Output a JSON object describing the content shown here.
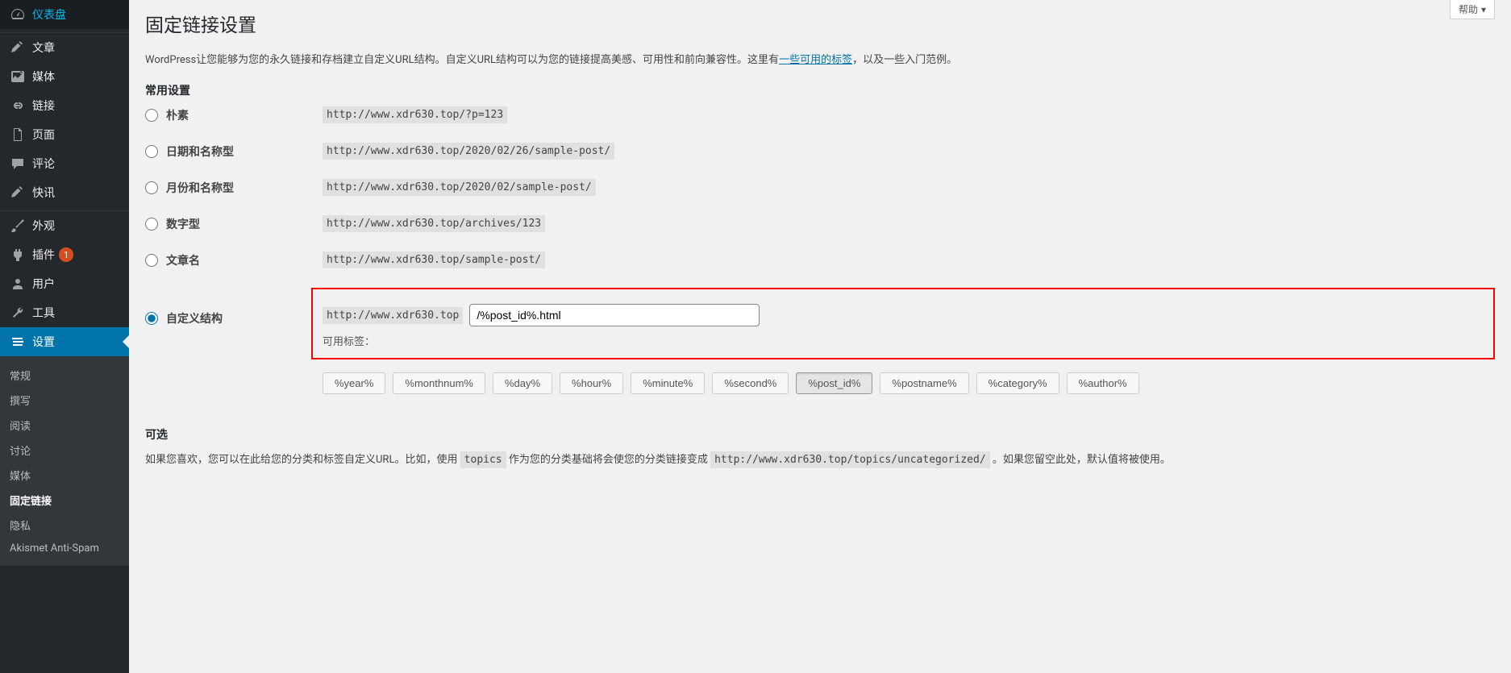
{
  "sidebar": {
    "main_items": [
      {
        "key": "dashboard",
        "label": "仪表盘"
      },
      {
        "key": "posts",
        "label": "文章"
      },
      {
        "key": "media",
        "label": "媒体"
      },
      {
        "key": "links",
        "label": "链接"
      },
      {
        "key": "pages",
        "label": "页面"
      },
      {
        "key": "comments",
        "label": "评论"
      },
      {
        "key": "news",
        "label": "快讯"
      },
      {
        "key": "appearance",
        "label": "外观"
      },
      {
        "key": "plugins",
        "label": "插件",
        "badge": "1"
      },
      {
        "key": "users",
        "label": "用户"
      },
      {
        "key": "tools",
        "label": "工具"
      },
      {
        "key": "settings",
        "label": "设置"
      }
    ],
    "submenu": [
      {
        "key": "general",
        "label": "常规"
      },
      {
        "key": "writing",
        "label": "撰写"
      },
      {
        "key": "reading",
        "label": "阅读"
      },
      {
        "key": "discussion",
        "label": "讨论"
      },
      {
        "key": "media-settings",
        "label": "媒体"
      },
      {
        "key": "permalinks",
        "label": "固定链接",
        "active": true
      },
      {
        "key": "privacy",
        "label": "隐私"
      },
      {
        "key": "akismet",
        "label": "Akismet Anti-Spam"
      }
    ]
  },
  "help_label": "帮助",
  "page_title": "固定链接设置",
  "description_pre": "WordPress让您能够为您的永久链接和存档建立自定义URL结构。自定义URL结构可以为您的链接提高美感、可用性和前向兼容性。这里有",
  "description_link": "一些可用的标签",
  "description_post": "，以及一些入门范例。",
  "common_settings_title": "常用设置",
  "permalink_options": [
    {
      "key": "plain",
      "label": "朴素",
      "example": "http://www.xdr630.top/?p=123"
    },
    {
      "key": "day-name",
      "label": "日期和名称型",
      "example": "http://www.xdr630.top/2020/02/26/sample-post/"
    },
    {
      "key": "month-name",
      "label": "月份和名称型",
      "example": "http://www.xdr630.top/2020/02/sample-post/"
    },
    {
      "key": "numeric",
      "label": "数字型",
      "example": "http://www.xdr630.top/archives/123"
    },
    {
      "key": "postname",
      "label": "文章名",
      "example": "http://www.xdr630.top/sample-post/"
    }
  ],
  "custom": {
    "label": "自定义结构",
    "prefix": "http://www.xdr630.top",
    "value": "/%post_id%.html",
    "available_tags_label": "可用标签："
  },
  "tags": [
    {
      "label": "%year%"
    },
    {
      "label": "%monthnum%"
    },
    {
      "label": "%day%"
    },
    {
      "label": "%hour%"
    },
    {
      "label": "%minute%"
    },
    {
      "label": "%second%"
    },
    {
      "label": "%post_id%",
      "active": true
    },
    {
      "label": "%postname%"
    },
    {
      "label": "%category%"
    },
    {
      "label": "%author%"
    }
  ],
  "optional_title": "可选",
  "optional_desc_pre": "如果您喜欢，您可以在此给您的分类和标签自定义URL。比如，使用 ",
  "optional_code1": "topics",
  "optional_desc_mid": " 作为您的分类基础将会使您的分类链接变成 ",
  "optional_code2": "http://www.xdr630.top/topics/uncategorized/",
  "optional_desc_post": " 。如果您留空此处，默认值将被使用。"
}
